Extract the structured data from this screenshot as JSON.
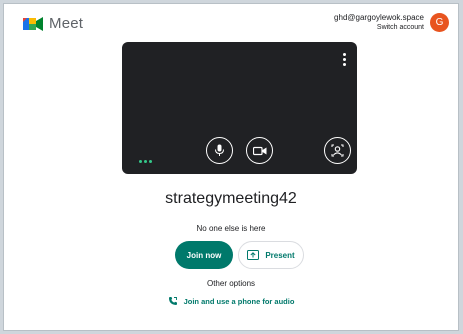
{
  "app": {
    "name": "Meet"
  },
  "account": {
    "email": "ghd@gargoylewok.space",
    "switch_label": "Switch account",
    "avatar_letter": "G"
  },
  "meeting": {
    "title": "strategymeeting42",
    "status": "No one else is here"
  },
  "actions": {
    "join_label": "Join now",
    "present_label": "Present"
  },
  "other": {
    "heading": "Other options",
    "phone_label": "Join and use a phone for audio"
  },
  "icons": [
    "meet-logo-icon",
    "more-vert-icon",
    "mic-icon",
    "camera-icon",
    "visual-effects-icon",
    "present-icon",
    "phone-icon"
  ],
  "colors": {
    "brand_green": "#00796b",
    "avatar": "#e8541f",
    "preview_bg": "#202124"
  }
}
